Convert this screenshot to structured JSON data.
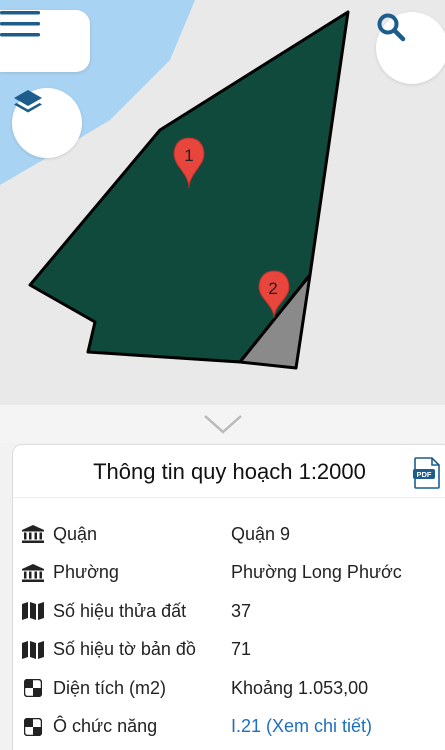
{
  "colors": {
    "parcel_fill": "#0f4a3c",
    "parcel_sub_fill": "#8a8a8a",
    "water": "#a9d3f2",
    "land": "#e9e9e9",
    "marker": "#e8453c",
    "link": "#1e6fbf",
    "accent_icon": "#1c5d8c"
  },
  "map": {
    "markers": [
      {
        "label": "1"
      },
      {
        "label": "2"
      }
    ]
  },
  "controls": {
    "menu_icon": "hamburger-menu-icon",
    "layers_icon": "layers-icon",
    "search_icon": "search-icon",
    "collapse_icon": "chevron-down-icon"
  },
  "panel": {
    "title": "Thông tin quy hoạch 1:2000",
    "pdf_icon": "pdf-icon",
    "rows": [
      {
        "icon": "building-icon",
        "label": "Quận",
        "value": "Quận 9"
      },
      {
        "icon": "building-icon",
        "label": "Phường",
        "value": "Phường Long Phước"
      },
      {
        "icon": "map-icon",
        "label": "Số hiệu thửa đất",
        "value": "37"
      },
      {
        "icon": "map-icon",
        "label": "Số hiệu tờ bản đồ",
        "value": "71"
      },
      {
        "icon": "checker-icon",
        "label": "Diện tích (m2)",
        "value": "Khoảng 1.053,00"
      },
      {
        "icon": "checker-icon",
        "label": "Ô chức năng",
        "value": "I.21 (Xem chi tiết)"
      }
    ]
  }
}
